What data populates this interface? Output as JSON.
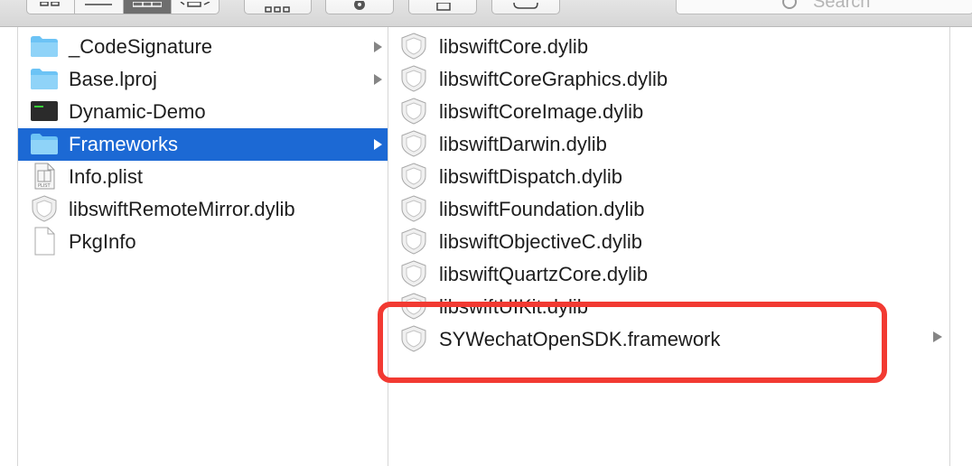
{
  "toolbar": {
    "search_placeholder": "Search",
    "icons": [
      "icon-view-icon",
      "list-view-icon",
      "column-view-icon",
      "cover-flow-icon",
      "arrange-icon",
      "action-gear-icon",
      "share-icon",
      "tag-icon"
    ]
  },
  "middle_column": {
    "items": [
      {
        "label": "_CodeSignature",
        "icon": "folder-icon",
        "has_children": true
      },
      {
        "label": "Base.lproj",
        "icon": "folder-icon",
        "has_children": true
      },
      {
        "label": "Dynamic-Demo",
        "icon": "terminal-exec-icon",
        "has_children": false
      },
      {
        "label": "Frameworks",
        "icon": "folder-icon",
        "has_children": true,
        "selected": true
      },
      {
        "label": "Info.plist",
        "icon": "plist-file-icon",
        "has_children": false
      },
      {
        "label": "libswiftRemoteMirror.dylib",
        "icon": "dylib-shield-icon",
        "has_children": false
      },
      {
        "label": "PkgInfo",
        "icon": "blank-document-icon",
        "has_children": false
      }
    ]
  },
  "right_column": {
    "items": [
      {
        "label": "libswiftCore.dylib",
        "icon": "dylib-shield-icon"
      },
      {
        "label": "libswiftCoreGraphics.dylib",
        "icon": "dylib-shield-icon"
      },
      {
        "label": "libswiftCoreImage.dylib",
        "icon": "dylib-shield-icon"
      },
      {
        "label": "libswiftDarwin.dylib",
        "icon": "dylib-shield-icon"
      },
      {
        "label": "libswiftDispatch.dylib",
        "icon": "dylib-shield-icon"
      },
      {
        "label": "libswiftFoundation.dylib",
        "icon": "dylib-shield-icon"
      },
      {
        "label": "libswiftObjectiveC.dylib",
        "icon": "dylib-shield-icon"
      },
      {
        "label": "libswiftQuartzCore.dylib",
        "icon": "dylib-shield-icon"
      },
      {
        "label": "libswiftUIKit.dylib",
        "icon": "dylib-shield-icon"
      },
      {
        "label": "SYWechatOpenSDK.framework",
        "icon": "framework-shield-icon",
        "has_children": true
      }
    ]
  },
  "colors": {
    "selection": "#1c69d4",
    "annotation": "#f23a32",
    "folder": "#6cc3f5"
  }
}
